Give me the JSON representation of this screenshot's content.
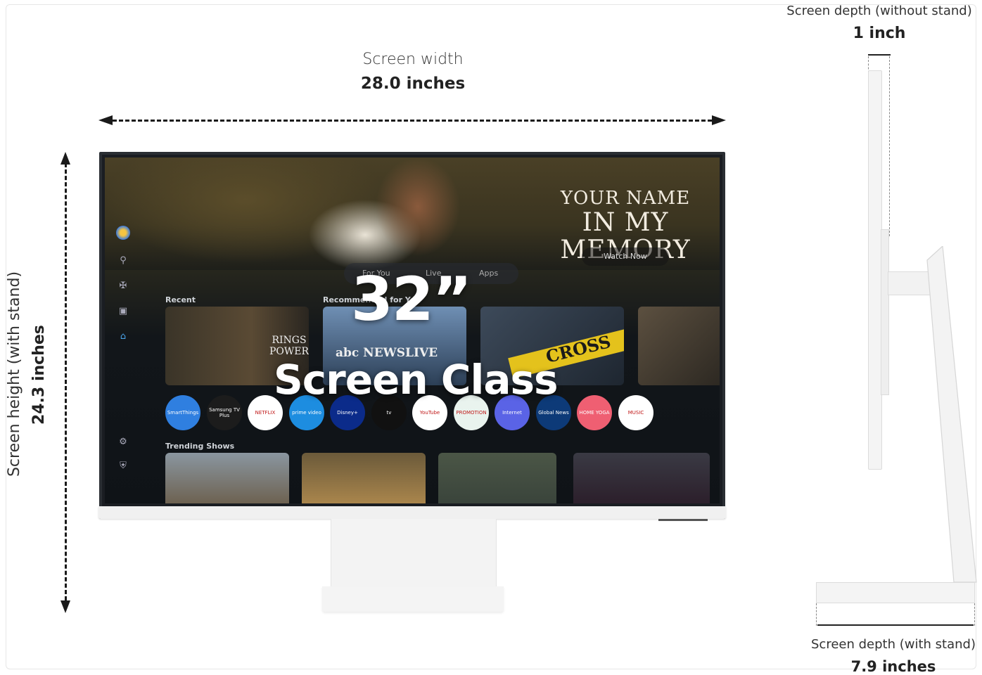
{
  "dimensions": {
    "screen_width": {
      "caption": "Screen width",
      "value": "28.0 inches"
    },
    "screen_height": {
      "caption": "Screen height (with stand)",
      "value": "24.3 inches"
    },
    "screen_depth_without_stand": {
      "caption": "Screen depth (without stand)",
      "value": "1 inch"
    },
    "screen_depth_with_stand": {
      "caption": "Screen depth (with stand)",
      "value": "7.9 inches"
    }
  },
  "overlay": {
    "size": "32”",
    "class": "Screen Class"
  },
  "tv_ui": {
    "hero": {
      "title_line1": "YOUR NAME",
      "title_line2": "IN MY MEMORY",
      "watch_now": "Watch Now"
    },
    "tabs": [
      "For You",
      "Live",
      "Apps"
    ],
    "rows": {
      "recent": "Recent",
      "recommended": "Recommended for You",
      "trending": "Trending Shows"
    },
    "card_texts": {
      "rings": "RINGS\nPOWER",
      "news": "abc NEWSLIVE",
      "cross": "CROSS"
    },
    "apps": [
      {
        "label": "SmartThings",
        "color": "#2f7fe0"
      },
      {
        "label": "Samsung TV Plus",
        "color": "#1c1c1c"
      },
      {
        "label": "NETFLIX",
        "color": "#ffffff"
      },
      {
        "label": "prime video",
        "color": "#1d8de0"
      },
      {
        "label": "Disney+",
        "color": "#0b2b8a"
      },
      {
        "label": "tv",
        "color": "#111111"
      },
      {
        "label": "YouTube",
        "color": "#ffffff"
      },
      {
        "label": "PROMOTION",
        "color": "#e9f3ee"
      },
      {
        "label": "Internet",
        "color": "#5a63e6"
      },
      {
        "label": "Global News",
        "color": "#0d3a78"
      },
      {
        "label": "HOME YOGA",
        "color": "#ef5f72"
      },
      {
        "label": "MUSIC",
        "color": "#ffffff"
      }
    ]
  }
}
